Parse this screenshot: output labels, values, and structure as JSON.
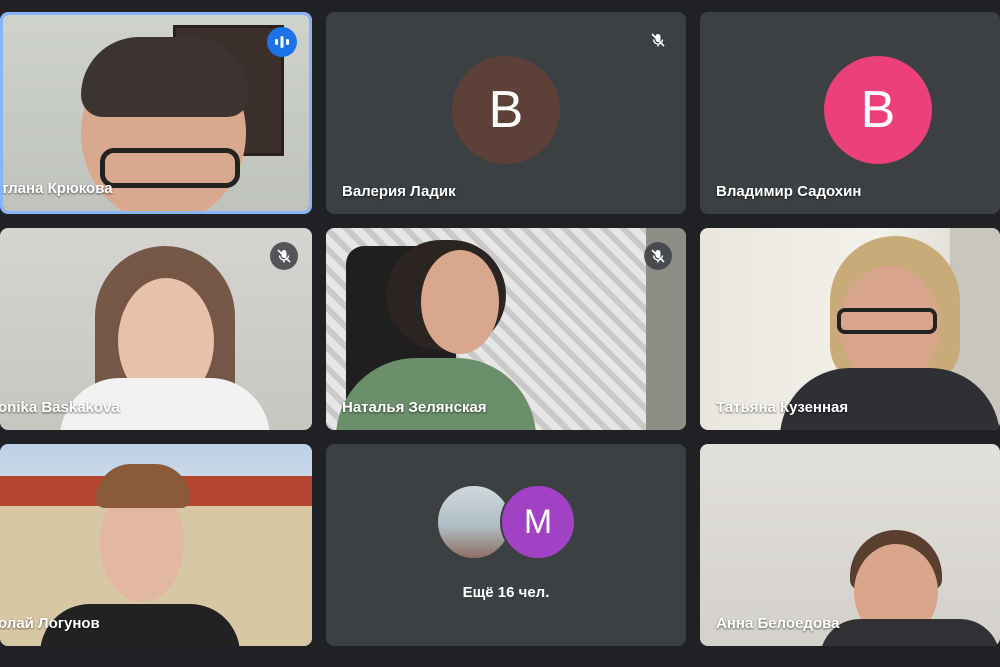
{
  "participants": [
    {
      "name": "тлана Крюкова",
      "speaking": true
    },
    {
      "name": "Валерия Ладик",
      "initial": "В",
      "avatar_color": "#5d4037",
      "muted": true
    },
    {
      "name": "Владимир Садохин",
      "initial": "В",
      "avatar_color": "#ec407a",
      "muted": false
    },
    {
      "name": "onika Baskakova",
      "muted": true
    },
    {
      "name": "Наталья Зелянская",
      "muted": true
    },
    {
      "name": "Татьяна Кузенная",
      "muted": false
    },
    {
      "name": "олай Логунов",
      "muted": false
    },
    {
      "name": "Анна Белоедова",
      "muted": false
    }
  ],
  "more": {
    "label": "Ещё 16 чел.",
    "avatar_initial": "M",
    "avatar_color": "#a142c4"
  },
  "colors": {
    "background": "#202124",
    "tile": "#3c4043",
    "speaking_border": "#8ab4f8",
    "speaking_badge": "#1a73e8"
  },
  "icons": {
    "mic_off": "mic-off-icon",
    "speaking": "audio-level-icon"
  }
}
